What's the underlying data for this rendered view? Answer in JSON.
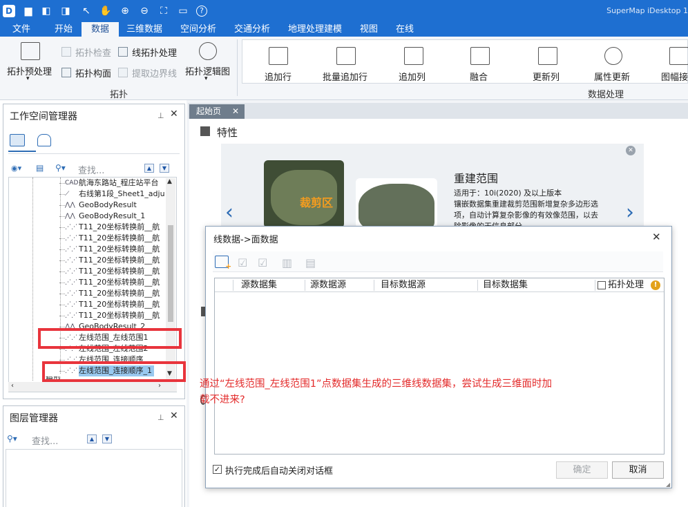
{
  "app": {
    "title": "SuperMap iDesktop 1"
  },
  "menus": [
    "文件",
    "开始",
    "数据",
    "三维数据",
    "空间分析",
    "交通分析",
    "地理处理建模",
    "视图",
    "在线"
  ],
  "active_menu": "数据",
  "ribbon": {
    "topo": {
      "preprocess": "拓扑预处理",
      "check": "拓扑检查",
      "line_process": "线拓扑处理",
      "build_polygon": "拓扑构面",
      "extract_boundary": "提取边界线",
      "logic_graph": "拓扑逻辑图",
      "group": "拓扑"
    },
    "data_processing": {
      "buttons": [
        "追加行",
        "批量追加行",
        "追加列",
        "融合",
        "更新列",
        "属性更新",
        "图幅接"
      ],
      "group": "数据处理"
    }
  },
  "workspace_panel": {
    "title": "工作空间管理器",
    "search_placeholder": "查找...",
    "items": [
      {
        "label": "航海东路站_程庄站平台",
        "icon": "cad"
      },
      {
        "label": "右线第1段_Sheet1_adju",
        "icon": "line"
      },
      {
        "label": "GeoBodyResult",
        "icon": "geobody"
      },
      {
        "label": "GeoBodyResult_1",
        "icon": "geobody"
      },
      {
        "label": "T11_20坐标转换前__航",
        "icon": "line3d"
      },
      {
        "label": "T11_20坐标转换前__航",
        "icon": "line3d"
      },
      {
        "label": "T11_20坐标转换前__航",
        "icon": "line3d"
      },
      {
        "label": "T11_20坐标转换前__航",
        "icon": "line3d"
      },
      {
        "label": "T11_20坐标转换前__航",
        "icon": "line3d"
      },
      {
        "label": "T11_20坐标转换前__航",
        "icon": "line3d"
      },
      {
        "label": "T11_20坐标转换前__航",
        "icon": "line3d"
      },
      {
        "label": "T11_20坐标转换前__航",
        "icon": "line3d"
      },
      {
        "label": "T11_20坐标转换前__航",
        "icon": "line3d"
      },
      {
        "label": "GeoBodyResult_2",
        "icon": "geobody"
      },
      {
        "label": "左线范围_左线范围1",
        "icon": "line3d"
      },
      {
        "label": "左线范围_左线范围2",
        "icon": "line3d"
      },
      {
        "label": "左线范围_连接顺序",
        "icon": "line3d"
      },
      {
        "label": "左线范围_连接顺序_1",
        "icon": "line3d",
        "selected": true
      }
    ],
    "partial_item": "模型"
  },
  "layer_panel": {
    "title": "图层管理器",
    "search_placeholder": "查找..."
  },
  "start_tab": "起始页",
  "feature": {
    "heading": "特性",
    "card_title": "重建范围",
    "card_body": "适用于：10i(2020) 及以上版本\n镶嵌数据集重建裁剪范围新增复杂多边形选项，自动计算复杂影像的有效像范围，以去除影像的无信息部分",
    "image_label": "裁剪区"
  },
  "dialog": {
    "title": "线数据->面数据",
    "columns": [
      "源数据集",
      "源数据源",
      "目标数据源",
      "目标数据集"
    ],
    "topo_label": "拓扑处理",
    "auto_close_label": "执行完成后自动关闭对话框",
    "ok": "确定",
    "cancel": "取消"
  },
  "annotation": "通过“左线范围_左线范围1”点数据集生成的三维线数据集，尝试生成三维面时加载不进来?",
  "colors": {
    "title_bar": "#1e6fd1",
    "annotation_red": "#e32a2a",
    "selection": "#99c9ef"
  }
}
